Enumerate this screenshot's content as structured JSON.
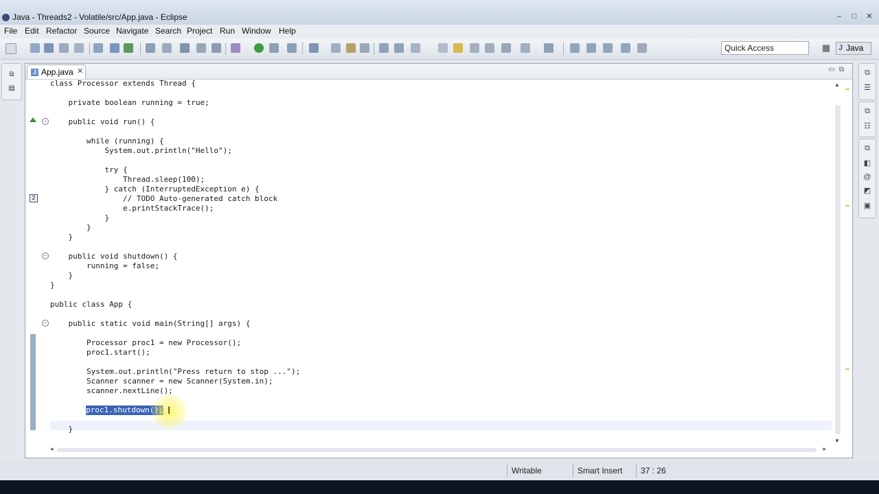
{
  "window": {
    "title": "Java - Threads2 - Volatile/src/App.java - Eclipse",
    "controls": [
      "–",
      "□",
      "✕"
    ]
  },
  "menu": [
    "File",
    "Edit",
    "Refactor",
    "Source",
    "Navigate",
    "Search",
    "Project",
    "Run",
    "Window",
    "Help"
  ],
  "toolbar": {
    "quick_access_placeholder": "Quick Access",
    "perspective": "Java"
  },
  "editor": {
    "tab_label": "App.java",
    "tab_close": "✕",
    "lines": [
      {
        "text": "class Processor extends Thread {"
      },
      {
        "text": ""
      },
      {
        "text": "    private boolean running = true;"
      },
      {
        "text": ""
      },
      {
        "text": "    public void run() {"
      },
      {
        "text": ""
      },
      {
        "text": "        while (running) {"
      },
      {
        "text": "            System.out.println(\"Hello\");"
      },
      {
        "text": ""
      },
      {
        "text": "            try {"
      },
      {
        "text": "                Thread.sleep(100);"
      },
      {
        "text": "            } catch (InterruptedException e) {"
      },
      {
        "text": "                // TODO Auto-generated catch block"
      },
      {
        "text": "                e.printStackTrace();"
      },
      {
        "text": "            }"
      },
      {
        "text": "        }"
      },
      {
        "text": "    }"
      },
      {
        "text": ""
      },
      {
        "text": "    public void shutdown() {"
      },
      {
        "text": "        running = false;"
      },
      {
        "text": "    }"
      },
      {
        "text": "}"
      },
      {
        "text": ""
      },
      {
        "text": "public class App {"
      },
      {
        "text": ""
      },
      {
        "text": "    public static void main(String[] args) {"
      },
      {
        "text": ""
      },
      {
        "text": "        Processor proc1 = new Processor();"
      },
      {
        "text": "        proc1.start();"
      },
      {
        "text": ""
      },
      {
        "text": "        System.out.println(\"Press return to stop ...\");"
      },
      {
        "text": "        Scanner scanner = new Scanner(System.in);"
      },
      {
        "text": "        scanner.nextLine();"
      },
      {
        "text": ""
      },
      {
        "text": "        proc1.shutdown();"
      },
      {
        "text": ""
      },
      {
        "text": "    }"
      }
    ]
  },
  "status": {
    "writable": "Writable",
    "insert_mode": "Smart Insert",
    "position": "37 : 26"
  },
  "colors": {
    "selection": "#3a63b5",
    "current_line": "#eef3fb",
    "occurrence": "#d4d4d4"
  }
}
